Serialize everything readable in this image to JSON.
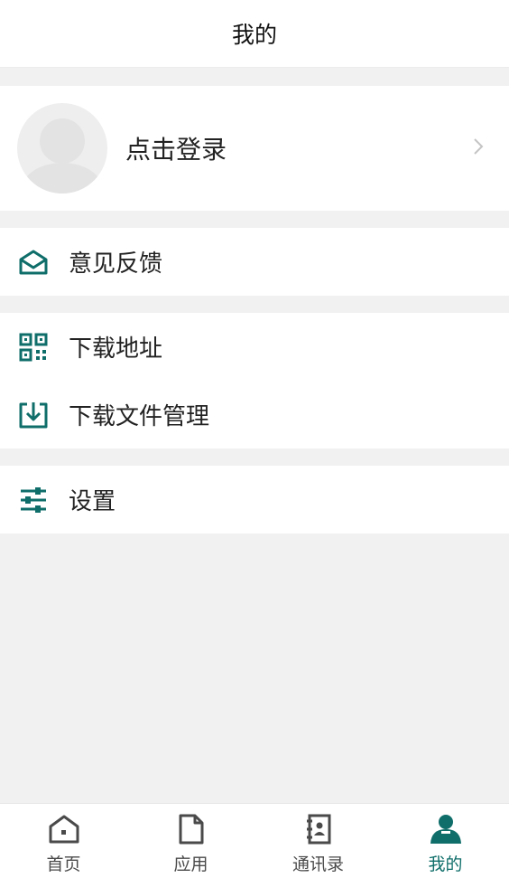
{
  "header": {
    "title": "我的"
  },
  "profile": {
    "login_label": "点击登录"
  },
  "menu": {
    "feedback": "意见反馈",
    "download_address": "下载地址",
    "download_files": "下载文件管理",
    "settings": "设置"
  },
  "tabbar": {
    "tabs": [
      {
        "label": "首页",
        "icon": "home-icon"
      },
      {
        "label": "应用",
        "icon": "document-icon"
      },
      {
        "label": "通讯录",
        "icon": "contacts-book-icon"
      },
      {
        "label": "我的",
        "icon": "user-icon",
        "active": true
      }
    ]
  },
  "colors": {
    "accent": "#0f6e6a",
    "background": "#f1f1f1",
    "tab_inactive": "#4a4a4a"
  }
}
